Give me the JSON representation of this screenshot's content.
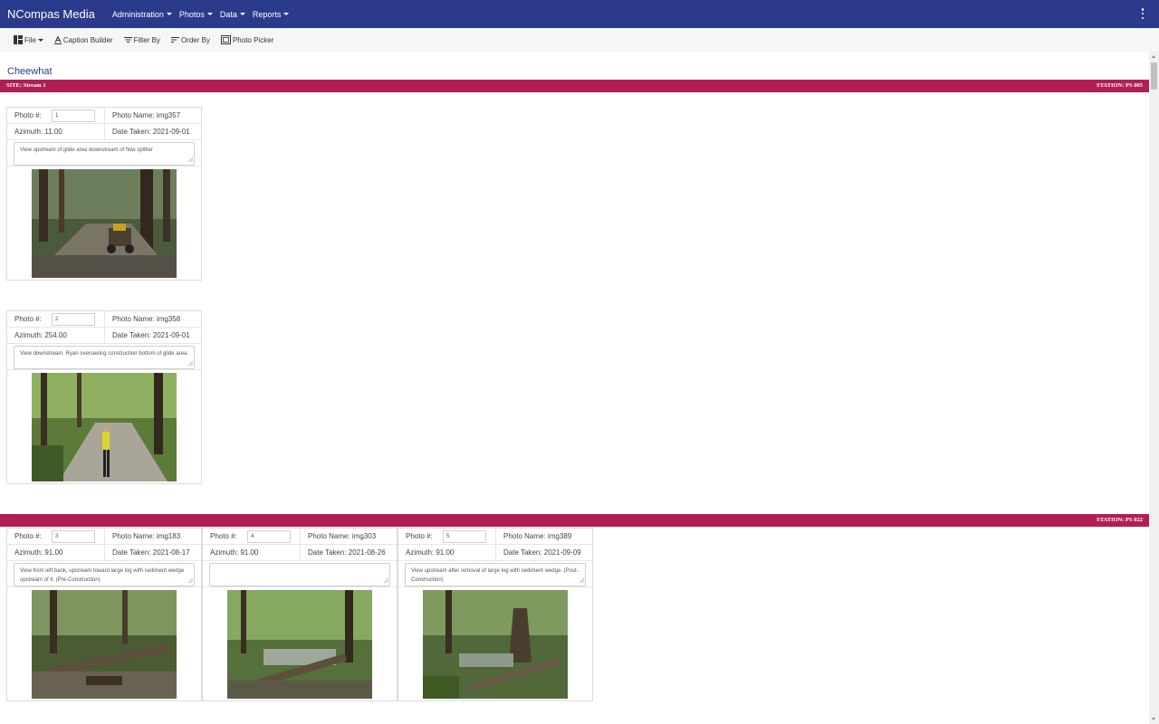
{
  "app": {
    "brand": "NCompas Media",
    "menu": [
      {
        "label": "Administration"
      },
      {
        "label": "Photos"
      },
      {
        "label": "Data"
      },
      {
        "label": "Reports"
      }
    ]
  },
  "toolbar": {
    "file": "File",
    "caption_builder": "Caption Builder",
    "filter_by": "Filter By",
    "order_by": "Order By",
    "photo_picker": "Photo Picker"
  },
  "project_title": "Cheewhat",
  "site1": {
    "site": "SITE: Stream 1",
    "station": "STATION: PS 005"
  },
  "site2": {
    "site": "",
    "station": "STATION: PS 022"
  },
  "labels": {
    "photo_num": "Photo #:",
    "photo_name_prefix": "Photo Name: ",
    "azimuth_prefix": "Azimuth: ",
    "date_prefix": "Date Taken: "
  },
  "photos": [
    {
      "num": "1",
      "name": "Photo Name: img357",
      "azimuth": "Azimuth: 11.00",
      "date": "Date Taken: 2021-09-01",
      "caption": "View upstream of glide area downstream of flow splitter"
    },
    {
      "num": "2",
      "name": "Photo Name: img358",
      "azimuth": "Azimuth: 254.00",
      "date": "Date Taken: 2021-09-01",
      "caption": "View downstream. Ryan overseeing construction bottom of glide area."
    },
    {
      "num": "3",
      "name": "Photo Name: img183",
      "azimuth": "Azimuth: 91.00",
      "date": "Date Taken: 2021-08-17",
      "caption": "View from left bank, upstream toward large log with sediment wedge upstream of it. (Pre-Construction)"
    },
    {
      "num": "4",
      "name": "Photo Name: img303",
      "azimuth": "Azimuth: 91.00",
      "date": "Date Taken: 2021-08-26",
      "caption": ""
    },
    {
      "num": "5",
      "name": "Photo Name: img389",
      "azimuth": "Azimuth: 91.00",
      "date": "Date Taken: 2021-09-09",
      "caption": "View upstream after removal of large log with sediment wedge. (Post-Construction)"
    }
  ],
  "colors": {
    "navbar": "#2b3b8c",
    "site_bar": "#b21f55",
    "toolbar_bg": "#f5f6f8",
    "title": "#2b3b8c"
  }
}
